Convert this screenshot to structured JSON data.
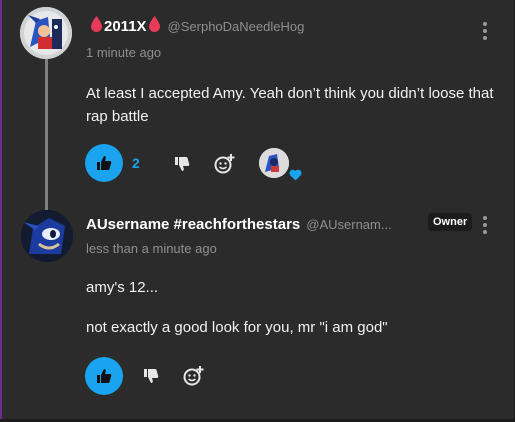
{
  "comments": [
    {
      "display_name": "2011X",
      "handle": "@SerphoDaNeedleHog",
      "timestamp": "1 minute ago",
      "text": "At least I accepted Amy. Yeah don’t think you didn’t loose that rap battle",
      "like_count": "2",
      "decor_emoji_color": "#e83a59",
      "reaction_heart_color": "#1aa3ef"
    },
    {
      "display_name": "AUsername #reachforthestars",
      "handle": "@AUsernam...",
      "badge": "Owner",
      "timestamp": "less than a minute ago",
      "paragraphs": [
        "amy's 12...",
        "not exactly a good look for you, mr \"i am god\""
      ]
    }
  ],
  "colors": {
    "accent": "#1aa3ef",
    "background": "#2b2b2b",
    "frame_accent": "#6a2d8f"
  },
  "icons": [
    "kebab-menu-icon",
    "thumbs-up-icon",
    "thumbs-down-icon",
    "add-reaction-icon",
    "blood-drop-icon",
    "heart-icon"
  ]
}
